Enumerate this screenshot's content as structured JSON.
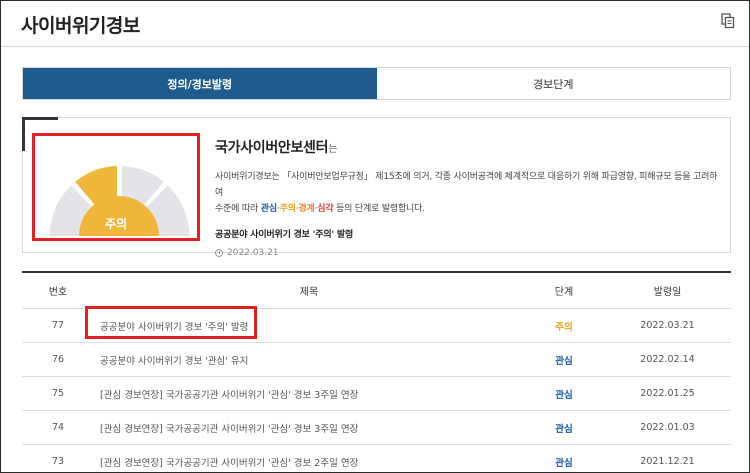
{
  "page": {
    "title": "사이버위기경보"
  },
  "tabs": [
    {
      "label": "정의/경보발령",
      "active": true
    },
    {
      "label": "경보단계",
      "active": false
    }
  ],
  "alert": {
    "current_level": "주의",
    "org": "국가사이버안보센터",
    "org_suffix": "는",
    "desc_line1": "사이버위기경보는 「사이버안보업무규정」 제15조에 의거, 각종 사이버공격에 체계적으로 대응하기 위해 파급영향, 피해규모 등을 고려하여",
    "desc_line2_prefix": "수준에 따라 ",
    "levels": [
      "관심",
      "주의",
      "경계",
      "심각"
    ],
    "desc_line2_suffix": " 등의 단계로 발령합니다.",
    "notice_title": "공공분야 사이버위기 경보 '주의' 발령",
    "notice_date": "2022.03.21"
  },
  "colors": {
    "brand": "#1f5c8d",
    "highlight": "#e31e24",
    "gauge_active": "#f0b63a",
    "gauge_inactive": "#e3e4e8",
    "level_interest": "#1a59a8",
    "level_caution": "#e6a117"
  },
  "table": {
    "headers": {
      "no": "번호",
      "title": "제목",
      "level": "단계",
      "date": "발령일"
    },
    "rows": [
      {
        "no": "77",
        "title": "공공분야 사이버위기 경보 '주의' 발령",
        "level": "주의",
        "date": "2022.03.21"
      },
      {
        "no": "76",
        "title": "공공분야 사이버위기 경보 '관심' 유지",
        "level": "관심",
        "date": "2022.02.14"
      },
      {
        "no": "75",
        "title": "[관심 경보연장] 국가공공기관 사이버위기 '관심' 경보 3주일 연장",
        "level": "관심",
        "date": "2022.01.25"
      },
      {
        "no": "74",
        "title": "[관심 경보연장] 국가공공기관 사이버위기 '관심' 경보 3주일 연장",
        "level": "관심",
        "date": "2022.01.03"
      },
      {
        "no": "73",
        "title": "[관심 경보연장] 국가공공기관 사이버위기 '관심' 경보 2주일 연장",
        "level": "관심",
        "date": "2021.12.21"
      }
    ]
  }
}
